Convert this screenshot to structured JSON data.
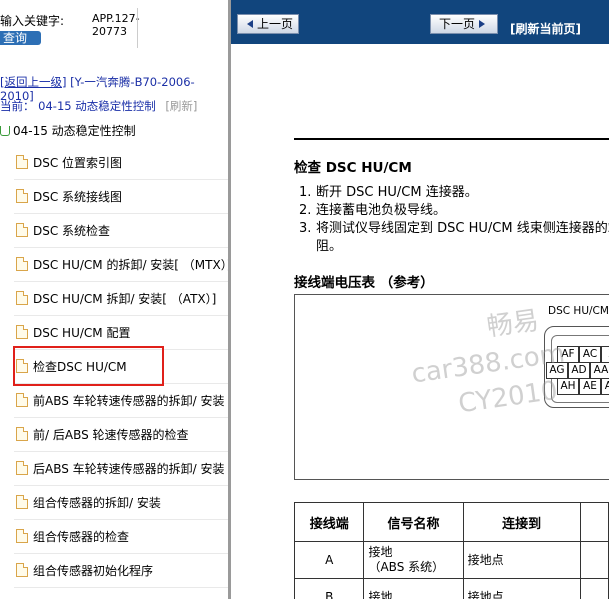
{
  "search": {
    "prompt": "输入关键字:",
    "button_label": "查询"
  },
  "app_id": {
    "line1": "APP.127-",
    "line2": "20773"
  },
  "breadcrumb": {
    "back_label": "[返回上一级]",
    "path": "[Y-一汽奔腾-B70-2006-2010]",
    "current_label": "当前：",
    "current_section": "04-15 动态稳定性控制",
    "refresh_label": "[刷新]"
  },
  "section": {
    "title": "04-15 动态稳定性控制"
  },
  "tree_items": [
    {
      "label": "DSC 位置索引图"
    },
    {
      "label": "DSC 系统接线图"
    },
    {
      "label": "DSC 系统检查"
    },
    {
      "label": "DSC HU/CM 的拆卸/ 安装[ （MTX）]"
    },
    {
      "label": "DSC HU/CM 拆卸/ 安装[ （ATX）]"
    },
    {
      "label": "DSC HU/CM 配置"
    },
    {
      "label": "检查DSC HU/CM"
    },
    {
      "label": "前ABS 车轮转速传感器的拆卸/ 安装"
    },
    {
      "label": "前/ 后ABS 轮速传感器的检查"
    },
    {
      "label": "后ABS 车轮转速传感器的拆卸/ 安装"
    },
    {
      "label": "组合传感器的拆卸/ 安装"
    },
    {
      "label": "组合传感器的检查"
    },
    {
      "label": "组合传感器初始化程序"
    }
  ],
  "toolbar": {
    "prev_label": "上一页",
    "next_label": "下一页",
    "refresh_label": "[刷新当前页]",
    "bar_color": "#11457d"
  },
  "document": {
    "title": "检查 DSC HU/CM",
    "steps": [
      {
        "num": "1.",
        "text": "断开 DSC HU/CM 连接器。"
      },
      {
        "num": "2.",
        "text": "连接蓄电池负极导线。"
      },
      {
        "num": "3.",
        "text": "将测试仪导线固定到 DSC HU/CM 线束侧连接器的端子上，测量电压和电"
      },
      {
        "num": "",
        "text": "阻。"
      }
    ],
    "voltage_heading": "接线端电压表 （参考）",
    "connector_label": "DSC HU/CM",
    "connector_pins_row1": [
      "AF",
      "AC",
      "Z"
    ],
    "connector_pins_row2": [
      "AG",
      "AD",
      "AA"
    ],
    "connector_pins_row3": [
      "AH",
      "AE",
      "AB"
    ],
    "watermark": {
      "line1": "畅易",
      "line2": "car388.com",
      "line3": "CY2010"
    },
    "table": {
      "headers": [
        "接线端",
        "信号名称",
        "连接到",
        ""
      ],
      "rows": [
        {
          "terminal": "A",
          "signal": "接地\n（ABS 系统）",
          "connect": "接地点"
        },
        {
          "terminal": "B",
          "signal": "接地",
          "connect": "接地点"
        }
      ]
    }
  }
}
